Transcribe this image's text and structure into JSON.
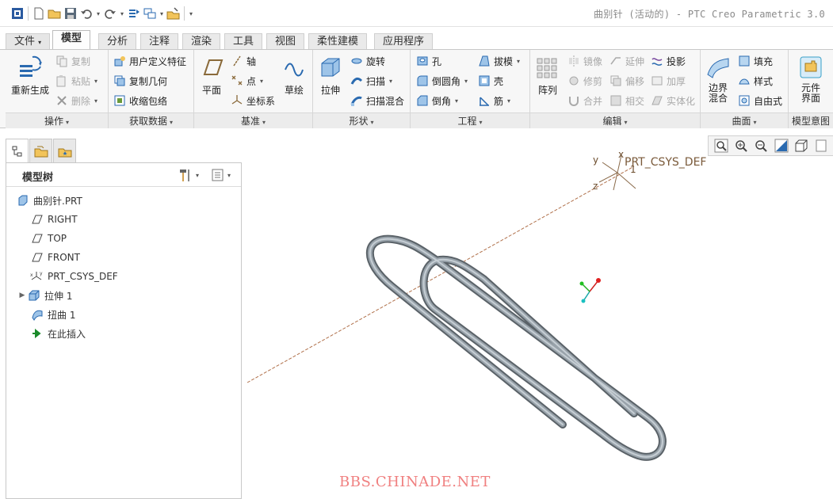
{
  "title": {
    "text": "曲别针 (活动的) - PTC Creo Parametric 3.0"
  },
  "tabs": [
    {
      "label": "文件",
      "arrow": "▾"
    },
    {
      "label": "模型"
    },
    {
      "label": "分析"
    },
    {
      "label": "注释"
    },
    {
      "label": "渲染"
    },
    {
      "label": "工具"
    },
    {
      "label": "视图"
    },
    {
      "label": "柔性建模"
    },
    {
      "label": "应用程序"
    }
  ],
  "ribbon": {
    "operations": {
      "label": "操作",
      "regenerate": "重新生成",
      "copy": "复制",
      "paste": "粘贴",
      "delete": "删除"
    },
    "get_data": {
      "label": "获取数据",
      "udf": "用户定义特征",
      "copy_geom": "复制几何",
      "shrinkwrap": "收缩包络"
    },
    "datum": {
      "label": "基准",
      "plane": "平面",
      "axis": "轴",
      "point": "点",
      "csys": "坐标系",
      "sketch": "草绘"
    },
    "shapes": {
      "label": "形状",
      "extrude": "拉伸",
      "revolve": "旋转",
      "sweep": "扫描",
      "swept_blend": "扫描混合"
    },
    "engineering": {
      "label": "工程",
      "hole": "孔",
      "round": "倒圆角",
      "chamfer": "倒角",
      "draft": "拔模",
      "shell": "壳",
      "rib": "筋"
    },
    "editing": {
      "label": "编辑",
      "pattern": "阵列",
      "mirror": "镜像",
      "trim": "修剪",
      "merge": "合并",
      "extend": "延伸",
      "offset": "偏移",
      "intersect": "相交",
      "project": "投影",
      "thicken": "加厚",
      "solidify": "实体化"
    },
    "surfaces": {
      "label": "曲面",
      "boundary_blend": "边界混合",
      "fill": "填充",
      "style": "样式",
      "freestyle": "自由式"
    },
    "model_intent": {
      "label": "模型意图",
      "component_interface": "元件界面"
    }
  },
  "model_tree": {
    "title": "模型树",
    "items": [
      {
        "label": "曲别针.PRT",
        "icon": "part-icon"
      },
      {
        "label": "RIGHT",
        "icon": "datum-plane-icon"
      },
      {
        "label": "TOP",
        "icon": "datum-plane-icon"
      },
      {
        "label": "FRONT",
        "icon": "datum-plane-icon"
      },
      {
        "label": "PRT_CSYS_DEF",
        "icon": "csys-icon"
      },
      {
        "label": "拉伸 1",
        "icon": "extrude-icon",
        "expandable": true
      },
      {
        "label": "扭曲 1",
        "icon": "warp-icon"
      },
      {
        "label": "在此插入",
        "icon": "insert-arrow-icon"
      }
    ]
  },
  "viewport": {
    "csys_label": "PRT_CSYS_DEF",
    "axis_x": "x",
    "axis_y": "y",
    "axis_z": "z",
    "axis_num": "1",
    "watermark": "BBS.CHINADE.NET"
  },
  "colors": {
    "accent": "#2a6ab0",
    "model_gray": "#8a939b",
    "datum_axis": "#b0704a",
    "watermark": "#f08080"
  }
}
